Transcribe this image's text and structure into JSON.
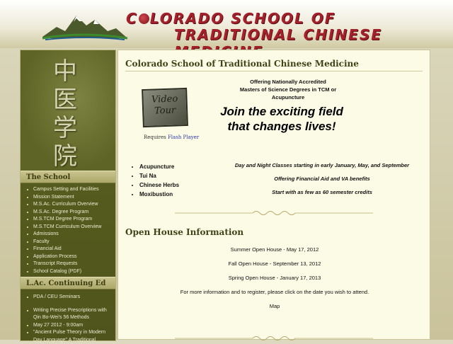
{
  "header": {
    "logo_line1_a": "C",
    "logo_line1_b": "LORADO SCHOOL OF",
    "logo_line2": "TRADITIONAL CHINESE MEDICINE"
  },
  "sidebar": {
    "characters": [
      "中",
      "医",
      "学",
      "院"
    ],
    "school_heading": "The School",
    "school_items": [
      "Campus Setting and Facilities",
      "Mission Statement",
      "M.S.Ac. Curriculum Overview",
      "M.S.Ac. Degree Program",
      "M.S.TCM Degree Program",
      "M.S.TCM Curriculum Overview",
      "Admissions",
      "Faculty",
      "Financial Aid",
      "Application Process",
      "Transcript Requests",
      "School Catalog (PDF)"
    ],
    "ce_heading": "L.Ac. Continuing Ed",
    "ce_items": [
      "PDA / CEU Seminars",
      "Writing Precise Prescriptions with Qin Bo-Wei's 56 Methods",
      "May 27 2012 - 9:00am",
      "\"Ancient Pulse Theory in Modern Day Language\" A Traditional"
    ]
  },
  "main": {
    "title": "Colorado School of Traditional Chinese Medicine",
    "video_label": "Video Tour",
    "requires_text": "Requires ",
    "flash_link": "Flash Player",
    "offer_lines": [
      "Offering Nationally Accredited",
      "Masters of Science Degrees in TCM or",
      "Acupuncture"
    ],
    "join_text": "Join the exciting field that changes lives!",
    "therapies": [
      "Acupuncture",
      "Tui Na",
      "Chinese Herbs",
      "Moxibustion"
    ],
    "classes_text": "Day and Night Classes starting in early January, May, and September",
    "financial_text": "Offering Financial Aid and VA benefits",
    "credits_text": "Start with as few as 60 semester credits",
    "open_house_title": "Open House Information",
    "open_houses": [
      "Summer Open House - May 17, 2012",
      "Fall Open House - September 13, 2012",
      "Spring Open House - January 17, 2013"
    ],
    "more_info": "For more information and to register, please click on the date you wish to attend.",
    "map_link": "Map"
  },
  "colors": {
    "logo_red": "#a4202a",
    "sidebar_olive": "#5e6425",
    "panel_cream": "#fbfbe6",
    "heading_green": "#3e4417",
    "link_blue": "#2d38a8"
  }
}
